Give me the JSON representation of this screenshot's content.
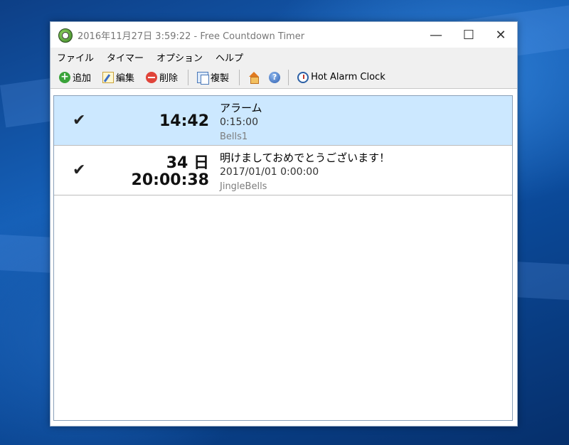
{
  "window": {
    "title": "2016年11月27日 3:59:22 - Free Countdown Timer",
    "controls": {
      "minimize": "—",
      "maximize": "☐",
      "close": "✕"
    }
  },
  "menu": [
    "ファイル",
    "タイマー",
    "オプション",
    "ヘルプ"
  ],
  "toolbar": {
    "add": "追加",
    "edit": "編集",
    "delete": "削除",
    "duplicate": "複製",
    "hot_alarm_clock": "Hot Alarm Clock",
    "help_glyph": "?"
  },
  "timers": [
    {
      "checked": true,
      "check_glyph": "✔",
      "time_line1": "14:42",
      "time_line2": "",
      "name": "アラーム",
      "target": "0:15:00",
      "sound": "Bells1",
      "selected": true
    },
    {
      "checked": true,
      "check_glyph": "✔",
      "time_line1": "34 日",
      "time_line2": "20:00:38",
      "name": "明けましておめでとうございます！",
      "target": "2017/01/01 0:00:00",
      "sound": "JingleBells",
      "selected": false
    }
  ],
  "icons": {
    "app": "countdown-clock-icon",
    "add": "plus-circle-icon",
    "edit": "pencil-note-icon",
    "delete": "minus-circle-icon",
    "duplicate": "copy-icon",
    "home": "home-icon",
    "help": "help-circle-icon",
    "alarm": "alarm-clock-icon"
  },
  "colors": {
    "selection": "#cce8ff",
    "desktop": "#1560b8"
  }
}
